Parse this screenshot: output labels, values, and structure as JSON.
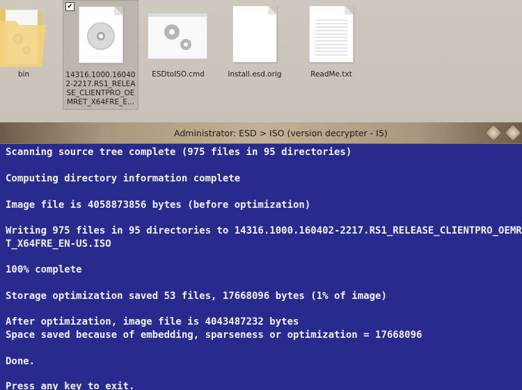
{
  "files": [
    {
      "name": "bin",
      "type": "folder"
    },
    {
      "name": "14316.1000.160402-2217.RS1_RELEASE_CLIENTPRO_OEMRET_X64FRE_E...",
      "type": "disc-image",
      "selected": true,
      "checked": "✔"
    },
    {
      "name": "ESDtoISO.cmd",
      "type": "cmd-script"
    },
    {
      "name": "Install.esd.orig",
      "type": "blank-file"
    },
    {
      "name": "ReadMe.txt",
      "type": "text-file"
    }
  ],
  "window": {
    "title": "Administrator:  ESD > ISO (version decrypter - I5)"
  },
  "console": {
    "lines": [
      "Scanning source tree complete (975 files in 95 directories)",
      "Computing directory information complete",
      "Image file is 4058873856 bytes (before optimization)",
      "Writing 975 files in 95 directories to 14316.1000.160402-2217.RS1_RELEASE_CLIENTPRO_OEMR",
      "T_X64FRE_EN-US.ISO",
      "100% complete",
      "Storage optimization saved 53 files, 17668096 bytes (1% of image)",
      "After optimization, image file is 4043487232 bytes",
      "Space saved because of embedding, sparseness or optimization = 17668096",
      "Done.",
      "Press any key to exit."
    ]
  },
  "colors": {
    "console_bg": "#282a8e",
    "console_text": "#f2f2f2",
    "explorer_bg": "#cdc6bd"
  }
}
